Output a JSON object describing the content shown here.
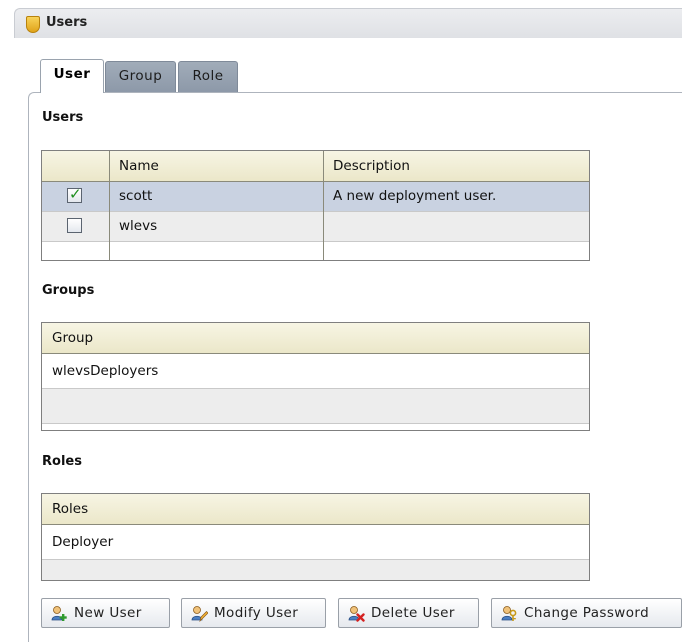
{
  "window": {
    "title": "Users"
  },
  "tabs": [
    {
      "label": "User",
      "active": true
    },
    {
      "label": "Group",
      "active": false
    },
    {
      "label": "Role",
      "active": false
    }
  ],
  "users_section": {
    "heading": "Users",
    "columns": [
      "",
      "Name",
      "Description"
    ],
    "rows": [
      {
        "checked": true,
        "name": "scott",
        "description": "A new deployment user."
      },
      {
        "checked": false,
        "name": "wlevs",
        "description": ""
      }
    ]
  },
  "groups_section": {
    "heading": "Groups",
    "column": "Group",
    "rows": [
      "wlevsDeployers",
      ""
    ]
  },
  "roles_section": {
    "heading": "Roles",
    "column": "Roles",
    "rows": [
      "Deployer",
      ""
    ]
  },
  "buttons": {
    "new_user": "New User",
    "modify_user": "Modify User",
    "delete_user": "Delete User",
    "change_password": "Change Password"
  },
  "colors": {
    "header_bg": "#ebe7c9",
    "selected_row": "#c9d2e1",
    "tab_inactive": "#95a1b0",
    "check": "#1f8f1f"
  },
  "icons": [
    "shield-icon",
    "checkbox-checked-icon",
    "checkbox-empty-icon",
    "new-user-icon",
    "modify-user-icon",
    "delete-user-icon",
    "change-password-icon"
  ]
}
